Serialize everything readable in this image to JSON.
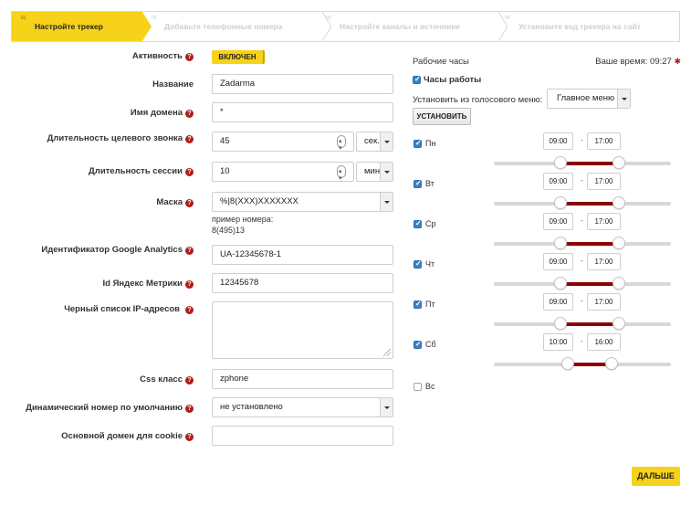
{
  "wizard": {
    "steps": [
      {
        "num": "01",
        "label": "Настройте трекер"
      },
      {
        "num": "02",
        "label": "Добавьте телефонные номера"
      },
      {
        "num": "03",
        "label": "Настройте каналы и источники"
      },
      {
        "num": "04",
        "label": "Установите код трекера на сайт"
      }
    ]
  },
  "form": {
    "activity": {
      "label": "Активность",
      "value": "ВКЛЮЧЕН"
    },
    "name": {
      "label": "Название",
      "value": "Zadarma"
    },
    "domain": {
      "label": "Имя домена",
      "value": "*"
    },
    "call_duration": {
      "label": "Длительность целевого звонка",
      "value": "45",
      "unit": "сек."
    },
    "session_duration": {
      "label": "Длительность сессии",
      "value": "10",
      "unit": "мин"
    },
    "mask": {
      "label": "Маска",
      "value": "%|8(XXX)XXXXXXX",
      "example_line1": "пример номера:",
      "example_line2": "8(495)13"
    },
    "ga": {
      "label": "Идентификатор Google Analytics",
      "value": "UA-12345678-1"
    },
    "ym": {
      "label": "Id Яндекс Метрики",
      "value": "12345678"
    },
    "blacklist": {
      "label": "Черный список IP-адресов",
      "value": ""
    },
    "css_class": {
      "label": "Css класс",
      "value": "zphone"
    },
    "dynamic_number": {
      "label": "Динамический номер по умолчанию",
      "value": "не установлено"
    },
    "cookie_domain": {
      "label": "Основной домен для cookie",
      "value": ""
    }
  },
  "hours": {
    "title": "Рабочие часы",
    "your_time_label": "Ваше время: 09:27",
    "working_hours_label": "Часы работы",
    "set_from_menu_label": "Установить из голосового меню:",
    "menu_value": "Главное меню",
    "set_button": "УСТАНОВИТЬ",
    "days": [
      {
        "label": "Пн",
        "checked": true,
        "from": "09:00",
        "to": "17:00",
        "from_frac": 0.375,
        "to_frac": 0.708
      },
      {
        "label": "Вт",
        "checked": true,
        "from": "09:00",
        "to": "17:00",
        "from_frac": 0.375,
        "to_frac": 0.708
      },
      {
        "label": "Ср",
        "checked": true,
        "from": "09:00",
        "to": "17:00",
        "from_frac": 0.375,
        "to_frac": 0.708
      },
      {
        "label": "Чт",
        "checked": true,
        "from": "09:00",
        "to": "17:00",
        "from_frac": 0.375,
        "to_frac": 0.708
      },
      {
        "label": "Пт",
        "checked": true,
        "from": "09:00",
        "to": "17:00",
        "from_frac": 0.375,
        "to_frac": 0.708
      },
      {
        "label": "Сб",
        "checked": true,
        "from": "10:00",
        "to": "16:00",
        "from_frac": 0.417,
        "to_frac": 0.667
      },
      {
        "label": "Вс",
        "checked": false
      }
    ]
  },
  "next_button": "ДАЛЬШЕ",
  "colors": {
    "accent": "#f7d21a",
    "range": "#8b0000",
    "help": "#b01c1c",
    "checkbox": "#3b82c4"
  }
}
